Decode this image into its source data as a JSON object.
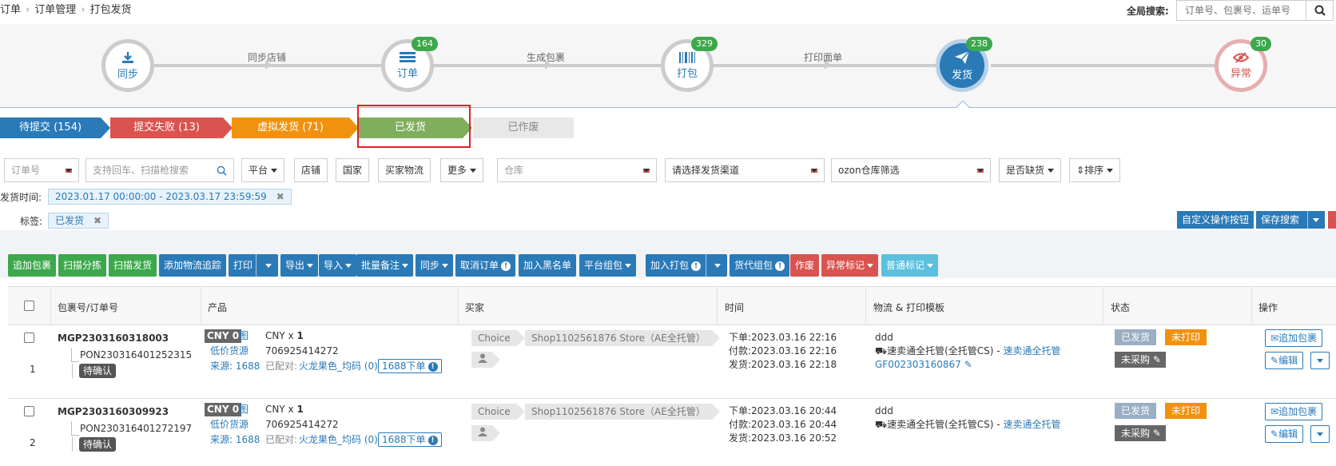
{
  "breadcrumb": {
    "items": [
      "订单",
      "订单管理",
      "打包发货"
    ]
  },
  "global_search": {
    "label": "全局搜索:",
    "placeholder": "订单号、包裹号、运单号"
  },
  "workflow": {
    "nodes": [
      {
        "label": "同步",
        "badge": "",
        "icon": "download-icon"
      },
      {
        "label": "订单",
        "badge": "164",
        "icon": "list-icon"
      },
      {
        "label": "打包",
        "badge": "329",
        "icon": "barcode-icon"
      },
      {
        "label": "发货",
        "badge": "238",
        "icon": "send-icon"
      },
      {
        "label": "异常",
        "badge": "30",
        "icon": "eye-slash-icon"
      }
    ],
    "links": [
      "同步店铺",
      "生成包裹",
      "打印面单"
    ]
  },
  "status_tabs": [
    {
      "label": "待提交 (154)",
      "color": "#2a7ab8"
    },
    {
      "label": "提交失败 (13)",
      "color": "#d9534f"
    },
    {
      "label": "虚拟发货 (71)",
      "color": "#f0920e"
    },
    {
      "label": "已发货",
      "color": "#7fae5c"
    },
    {
      "label": "已作废",
      "color": "#e8e8e8"
    }
  ],
  "filters": {
    "order_no": "订单号",
    "search_placeholder": "支持回车、扫描枪搜索",
    "platform": "平台",
    "store": "店铺",
    "country": "国家",
    "buyer_logistics": "买家物流",
    "more": "更多",
    "warehouse": "仓库",
    "channel": "请选择发货渠道",
    "ozon": "ozon仓库筛选",
    "shortage": "是否缺货",
    "sort": "排序"
  },
  "ship_time": {
    "label": "发货时间:",
    "value": "2023.01.17 00:00:00 - 2023.03.17 23:59:59"
  },
  "tag_filter": {
    "label": "标签:",
    "value": "已发货"
  },
  "right_buttons": {
    "custom": "自定义操作按钮",
    "save_search": "保存搜索"
  },
  "actions": [
    "追加包裹",
    "扫描分拣",
    "扫描发货",
    "添加物流追踪",
    "打印",
    "导出",
    "导入",
    "批量备注",
    "同步",
    "取消订单",
    "加入黑名单",
    "平台组包",
    "加入打包",
    "货代组包",
    "作废",
    "异常标记",
    "普通标记"
  ],
  "table": {
    "headers": [
      "包裹号/订单号",
      "产品",
      "买家",
      "时间",
      "物流 & 打印模板",
      "状态",
      "操作"
    ],
    "rows": [
      {
        "index": "1",
        "package_no": "MGP2303160318003",
        "order_no": "PON230316401252315",
        "order_tag": "待确认",
        "currency_badge": "CNY 0",
        "img_label": "图",
        "low_price": "低价货源",
        "source": "来源: 1688",
        "product_qty_prefix": "CNY x",
        "product_qty": "1",
        "product_id": "706925414272",
        "matched_label": "已配对:",
        "matched_value": "火龙果色_均码 (0)",
        "order1688": "1688下单",
        "buyer_tag": "Choice",
        "store": "Shop1102561876 Store（AE全托管）",
        "t_order": "下单:2023.03.16 22:16",
        "t_pay": "付款:2023.03.16 22:16",
        "t_ship": "发货:2023.03.16 22:18",
        "logistics": "ddd",
        "carrier": "速卖通全托管(全托管CS) -",
        "carrier_link": "速卖通全托管",
        "tracking": "GF002303160867",
        "status1": "已发货",
        "status2": "未打印",
        "status3": "未采购",
        "op1": "追加包裹",
        "op2": "编辑"
      },
      {
        "index": "2",
        "package_no": "MGP2303160309923",
        "order_no": "PON230316401272197",
        "order_tag": "待确认",
        "currency_badge": "CNY 0",
        "img_label": "图",
        "low_price": "低价货源",
        "source": "来源: 1688",
        "product_qty_prefix": "CNY x",
        "product_qty": "1",
        "product_id": "706925414272",
        "matched_label": "已配对:",
        "matched_value": "火龙果色_均码 (0)",
        "order1688": "1688下单",
        "buyer_tag": "Choice",
        "store": "Shop1102561876 Store（AE全托管）",
        "t_order": "下单:2023.03.16 20:44",
        "t_pay": "付款:2023.03.16 20:44",
        "t_ship": "发货:2023.03.16 20:52",
        "logistics": "ddd",
        "carrier": "速卖通全托管(全托管CS) -",
        "carrier_link": "速卖通全托管",
        "tracking": "",
        "status1": "已发货",
        "status2": "未打印",
        "status3": "未采购",
        "op1": "追加包裹",
        "op2": "编辑"
      }
    ]
  }
}
